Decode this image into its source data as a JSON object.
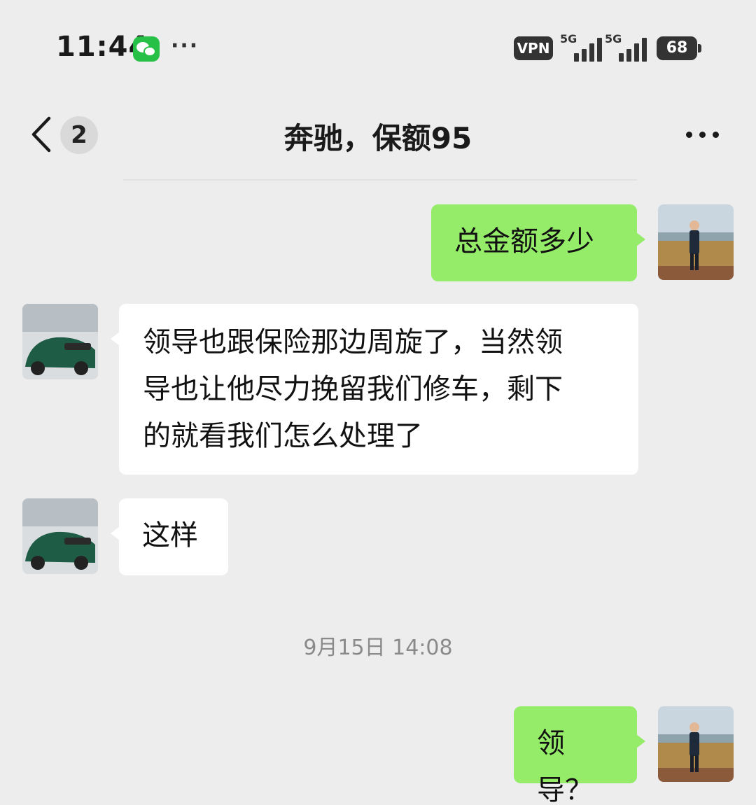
{
  "status_bar": {
    "time": "11:44",
    "notification_icon": "wechat-icon",
    "more_indicator": "···",
    "vpn_label": "VPN",
    "signal_1_label": "5G",
    "signal_2_label": "5G",
    "battery_level": "68"
  },
  "nav": {
    "back_icon": "chevron-left-icon",
    "unread_count": "2",
    "title": "奔驰，保额95",
    "more_icon": "more-dots-icon"
  },
  "messages": [
    {
      "sender": "me",
      "text": "总金额多少"
    },
    {
      "sender": "other",
      "lines": [
        "领导也跟保险那边周旋了，当然领",
        "导也让他尽力挽留我们修车，剩下",
        "的就看我们怎么处理了"
      ]
    },
    {
      "sender": "other",
      "text": "这样"
    },
    {
      "sender": "me",
      "text": "领导？"
    }
  ],
  "timestamp": "9月15日 14:08",
  "colors": {
    "background": "#ededed",
    "my_bubble": "#95ec69",
    "other_bubble": "#ffffff",
    "wechat_green": "#27c046"
  }
}
